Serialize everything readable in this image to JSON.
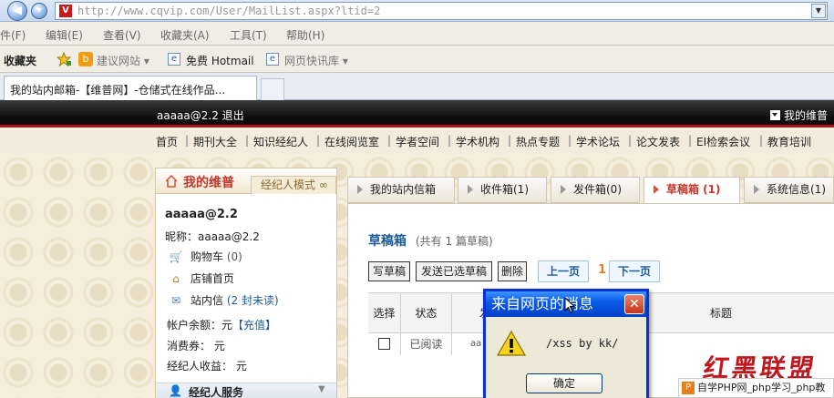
{
  "browser": {
    "url": "http://www.cqvip.com/User/MailList.aspx?ltid=2",
    "menu": [
      "件(F)",
      "编辑(E)",
      "查看(V)",
      "收藏夹(A)",
      "工具(T)",
      "帮助(H)"
    ],
    "favorites_label": "收藏夹",
    "fav_items": [
      "建议网站 ▾",
      "免费 Hotmail",
      "网页快讯库 ▾"
    ],
    "tab_title": "我的站内邮箱-【维普网】-仓储式在线作品..."
  },
  "site": {
    "user_line": "aaaaa@2.2 退出",
    "my_vip": "我的维普",
    "nav": [
      "首页",
      "期刊大全",
      "知识经纪人",
      "在线阅览室",
      "学者空间",
      "学术机构",
      "热点专题",
      "学术论坛",
      "论文发表",
      "EI检索会议",
      "教育培训"
    ]
  },
  "left_panel": {
    "title": "我的维普",
    "mode_tab": "经纪人模式 ∞",
    "username": "aaaaa@2.2",
    "nickname": "昵称：aaaaa@2.2",
    "cart": "购物车",
    "cart_count": "(0)",
    "store": "店铺首页",
    "mail": "站内信",
    "mail_unread": "(2 封未读)",
    "balance_label": "帐户余额：",
    "balance_value": "元",
    "recharge": "【充值】",
    "coupon": "消费券：  元",
    "income": "经纪人收益：  元",
    "broker_service": "经纪人服务"
  },
  "mail_tabs": [
    "我的站内信箱",
    "收件箱(1)",
    "发件箱(0)",
    "草稿箱 (1)",
    "系统信息(1)"
  ],
  "content": {
    "title": "草稿箱",
    "subtitle": "(共有 1 篇草稿)",
    "buttons": [
      "写草稿",
      "发送已选草稿",
      "删除"
    ],
    "prev": "上一页",
    "page": "1",
    "next": "下一页",
    "columns": [
      "选择",
      "状态",
      "发",
      "标题"
    ],
    "rows": [
      {
        "status": "已阅读",
        "sender": "aa"
      }
    ]
  },
  "dialog": {
    "title": "来自网页的消息",
    "close": "✕",
    "message": "/xss by kk/",
    "ok": "确定"
  },
  "watermarks": {
    "big": "红黑联盟",
    "php": "自学PHP网_php学习_php教"
  },
  "colors": {
    "accent_red": "#c0392b",
    "link_blue": "#1c5a9a",
    "dialog_blue": "#0831d9"
  }
}
